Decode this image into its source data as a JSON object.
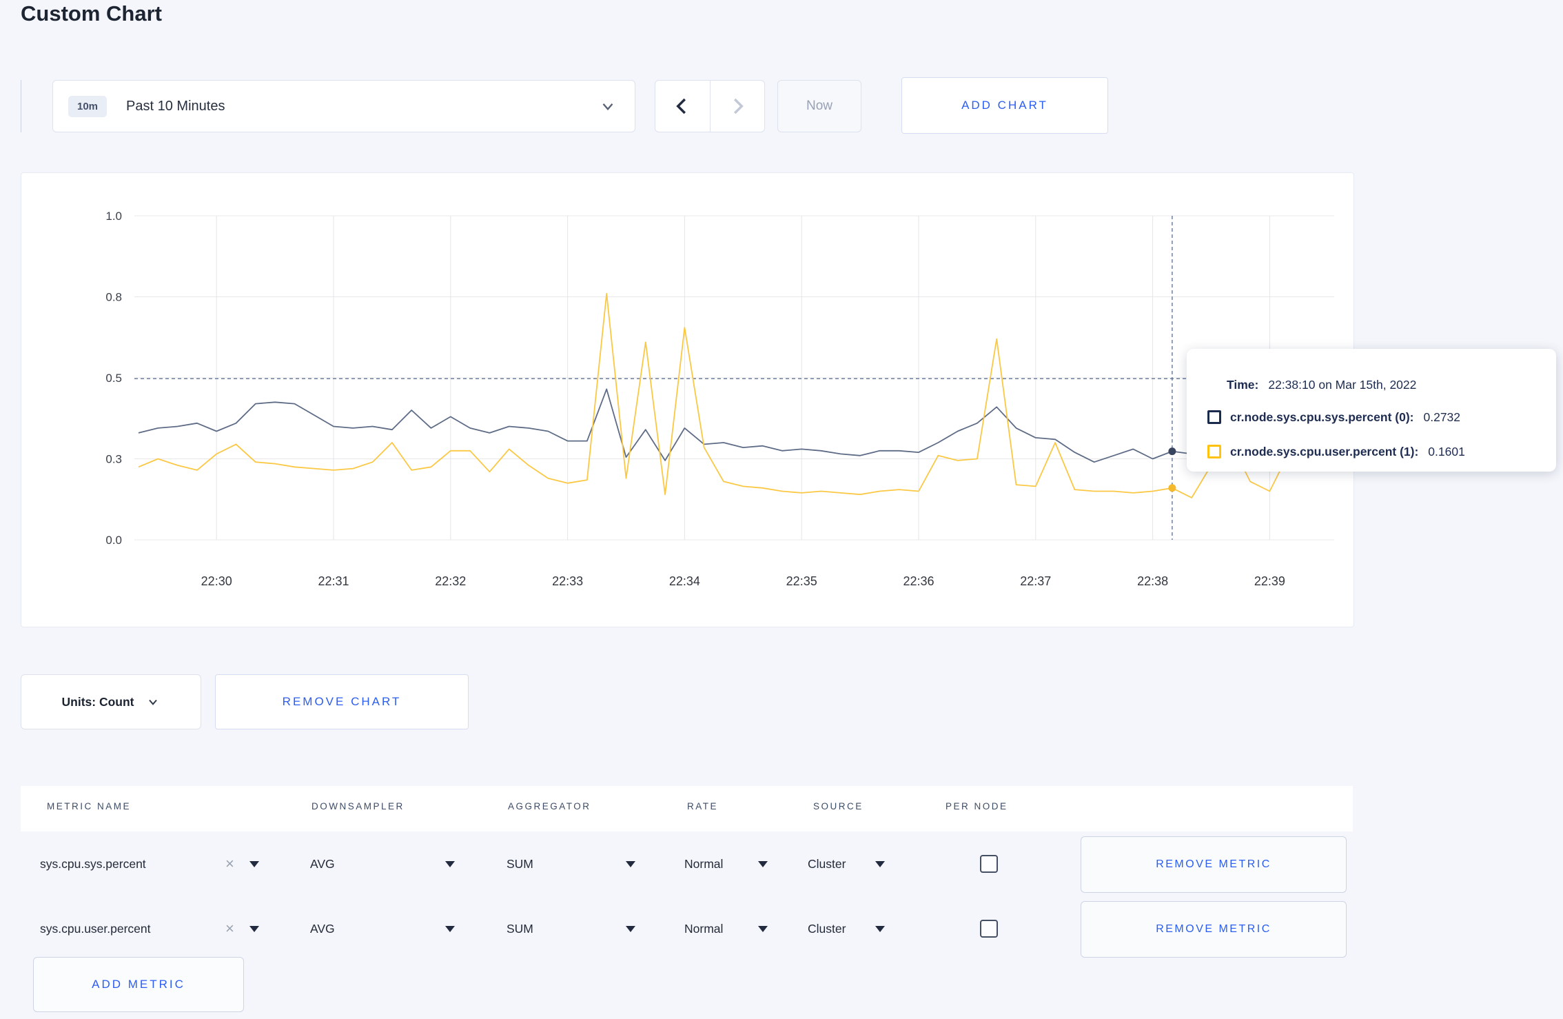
{
  "page": {
    "title": "Custom Chart"
  },
  "toolbar": {
    "time_range": {
      "badge": "10m",
      "label": "Past 10 Minutes"
    },
    "prev_icon": "chevron-left",
    "next_icon": "chevron-right",
    "now_label": "Now",
    "add_chart_label": "ADD CHART"
  },
  "colors": {
    "accent_blue": "#2b5df0",
    "series_sys_line": "#5d6b86",
    "series_sys_swatch": "#1b2b4e",
    "series_user_line": "#fbc844",
    "series_user_swatch": "#ffc20e",
    "page_background": "#f4f6fb",
    "grid_line": "#e8e8ea",
    "crosshair": "#64789a"
  },
  "chart_data": {
    "type": "line",
    "title": "",
    "xlabel": "",
    "ylabel": "",
    "ylim": [
      0,
      1
    ],
    "grid": true,
    "legend_position": "tooltip-only",
    "x_start": "22:29:20",
    "x_step_seconds": 10,
    "x_ticks": [
      {
        "index": 4,
        "label": "22:30"
      },
      {
        "index": 10,
        "label": "22:31"
      },
      {
        "index": 16,
        "label": "22:32"
      },
      {
        "index": 22,
        "label": "22:33"
      },
      {
        "index": 28,
        "label": "22:34"
      },
      {
        "index": 34,
        "label": "22:35"
      },
      {
        "index": 40,
        "label": "22:36"
      },
      {
        "index": 46,
        "label": "22:37"
      },
      {
        "index": 52,
        "label": "22:38"
      },
      {
        "index": 58,
        "label": "22:39"
      }
    ],
    "y_ticks": [
      {
        "value": 0,
        "label": "0.0"
      },
      {
        "value": 0.25,
        "label": "0.3"
      },
      {
        "value": 0.5,
        "label": "0.5"
      },
      {
        "value": 0.75,
        "label": "0.8"
      },
      {
        "value": 1,
        "label": "1.0"
      }
    ],
    "hover": {
      "index": 53,
      "time": "22:38:10 on Mar 15th, 2022",
      "y_line_value": 0.4975
    },
    "series": [
      {
        "name": "cr.node.sys.cpu.sys.percent (0)",
        "color": "#5d6b86",
        "dot_color": "#39455f",
        "hover_value": 0.2732,
        "values": [
          0.33,
          0.345,
          0.35,
          0.36,
          0.335,
          0.36,
          0.42,
          0.425,
          0.42,
          0.385,
          0.35,
          0.345,
          0.35,
          0.34,
          0.4,
          0.345,
          0.38,
          0.345,
          0.33,
          0.35,
          0.345,
          0.335,
          0.305,
          0.305,
          0.465,
          0.255,
          0.34,
          0.245,
          0.345,
          0.295,
          0.3,
          0.285,
          0.29,
          0.275,
          0.28,
          0.275,
          0.265,
          0.26,
          0.275,
          0.275,
          0.27,
          0.3,
          0.335,
          0.36,
          0.41,
          0.345,
          0.315,
          0.31,
          0.27,
          0.24,
          0.26,
          0.28,
          0.25,
          0.2732,
          0.265,
          0.26,
          0.27,
          0.31,
          0.295,
          0.31
        ]
      },
      {
        "name": "cr.node.sys.cpu.user.percent (1)",
        "color": "#fbc844",
        "dot_color": "#f5b92e",
        "hover_value": 0.1601,
        "values": [
          0.225,
          0.25,
          0.23,
          0.215,
          0.265,
          0.295,
          0.24,
          0.235,
          0.225,
          0.22,
          0.215,
          0.22,
          0.24,
          0.3,
          0.215,
          0.225,
          0.275,
          0.275,
          0.21,
          0.28,
          0.23,
          0.19,
          0.175,
          0.185,
          0.76,
          0.19,
          0.61,
          0.14,
          0.655,
          0.285,
          0.18,
          0.165,
          0.16,
          0.15,
          0.145,
          0.15,
          0.145,
          0.14,
          0.15,
          0.155,
          0.15,
          0.26,
          0.245,
          0.25,
          0.62,
          0.17,
          0.165,
          0.3,
          0.155,
          0.15,
          0.15,
          0.145,
          0.15,
          0.1601,
          0.13,
          0.23,
          0.3,
          0.18,
          0.15,
          0.27
        ]
      }
    ]
  },
  "tooltip": {
    "time_label": "Time:",
    "time_value": "22:38:10 on Mar 15th, 2022",
    "series": [
      {
        "name": "cr.node.sys.cpu.sys.percent (0):",
        "value": "0.2732"
      },
      {
        "name": "cr.node.sys.cpu.user.percent (1):",
        "value": "0.1601"
      }
    ]
  },
  "units_bar": {
    "units_label": "Units: Count",
    "remove_chart_label": "REMOVE CHART"
  },
  "metrics_table": {
    "headers": {
      "metric_name": "METRIC NAME",
      "downsampler": "DOWNSAMPLER",
      "aggregator": "AGGREGATOR",
      "rate": "RATE",
      "source": "SOURCE",
      "per_node": "PER NODE"
    },
    "rows": [
      {
        "metric": "sys.cpu.sys.percent",
        "downsampler": "AVG",
        "aggregator": "SUM",
        "rate": "Normal",
        "source": "Cluster",
        "per_node_checked": false,
        "remove_label": "REMOVE METRIC"
      },
      {
        "metric": "sys.cpu.user.percent",
        "downsampler": "AVG",
        "aggregator": "SUM",
        "rate": "Normal",
        "source": "Cluster",
        "per_node_checked": false,
        "remove_label": "REMOVE METRIC"
      }
    ],
    "add_metric_label": "ADD METRIC"
  }
}
